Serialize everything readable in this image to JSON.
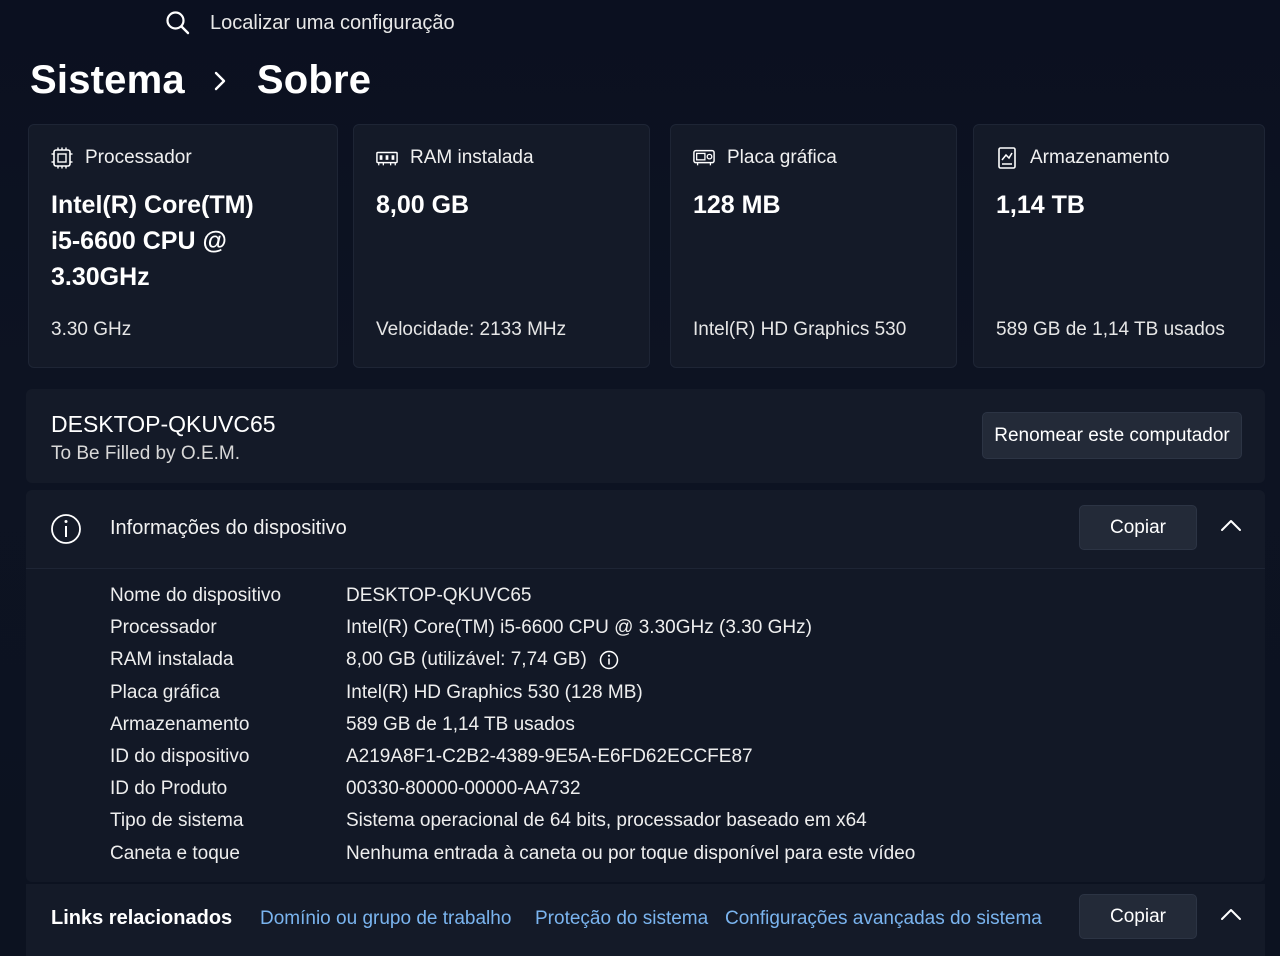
{
  "search": {
    "placeholder": "Localizar uma configuração"
  },
  "breadcrumb": {
    "parent": "Sistema",
    "current": "Sobre"
  },
  "cards": [
    {
      "title": "Processador",
      "value": "Intel(R) Core(TM)\ni5-6600 CPU @\n3.30GHz",
      "sub": "3.30 GHz",
      "icon": "processor-icon"
    },
    {
      "title": "RAM instalada",
      "value": "8,00 GB",
      "sub": "Velocidade: 2133 MHz",
      "icon": "ram-icon"
    },
    {
      "title": "Placa gráfica",
      "value": "128 MB",
      "sub": "Intel(R) HD Graphics 530",
      "icon": "graphics-card-icon"
    },
    {
      "title": "Armazenamento",
      "value": "1,14 TB",
      "sub": "589 GB de 1,14 TB usados",
      "icon": "storage-icon"
    }
  ],
  "device": {
    "name": "DESKTOP-QKUVC65",
    "model": "To Be Filled by O.E.M.",
    "rename_label": "Renomear este computador"
  },
  "device_info": {
    "title": "Informações do dispositivo",
    "copy_label": "Copiar",
    "rows": [
      {
        "label": "Nome do dispositivo",
        "value": "DESKTOP-QKUVC65"
      },
      {
        "label": "Processador",
        "value": "Intel(R) Core(TM) i5-6600 CPU @ 3.30GHz (3.30 GHz)"
      },
      {
        "label": "RAM instalada",
        "value": "8,00 GB (utilizável: 7,74 GB)"
      },
      {
        "label": "Placa gráfica",
        "value": "Intel(R) HD Graphics 530 (128 MB)"
      },
      {
        "label": "Armazenamento",
        "value": "589 GB de 1,14 TB usados"
      },
      {
        "label": "ID do dispositivo",
        "value": "A219A8F1-C2B2-4389-9E5A-E6FD62ECCFE87"
      },
      {
        "label": "ID do Produto",
        "value": "00330-80000-00000-AA732"
      },
      {
        "label": "Tipo de sistema",
        "value": "Sistema operacional de 64 bits, processador baseado em x64"
      },
      {
        "label": "Caneta e toque",
        "value": "Nenhuma entrada à caneta ou por toque disponível para este vídeo"
      }
    ]
  },
  "related_links": {
    "title": "Links relacionados",
    "links": [
      "Domínio ou grupo de trabalho",
      "Proteção do sistema",
      "Configurações avançadas do sistema"
    ],
    "copy_label": "Copiar"
  },
  "colors": {
    "background": "#0b1020",
    "card": "#141a28",
    "link": "#7ab4ef",
    "button": "#232a38"
  }
}
